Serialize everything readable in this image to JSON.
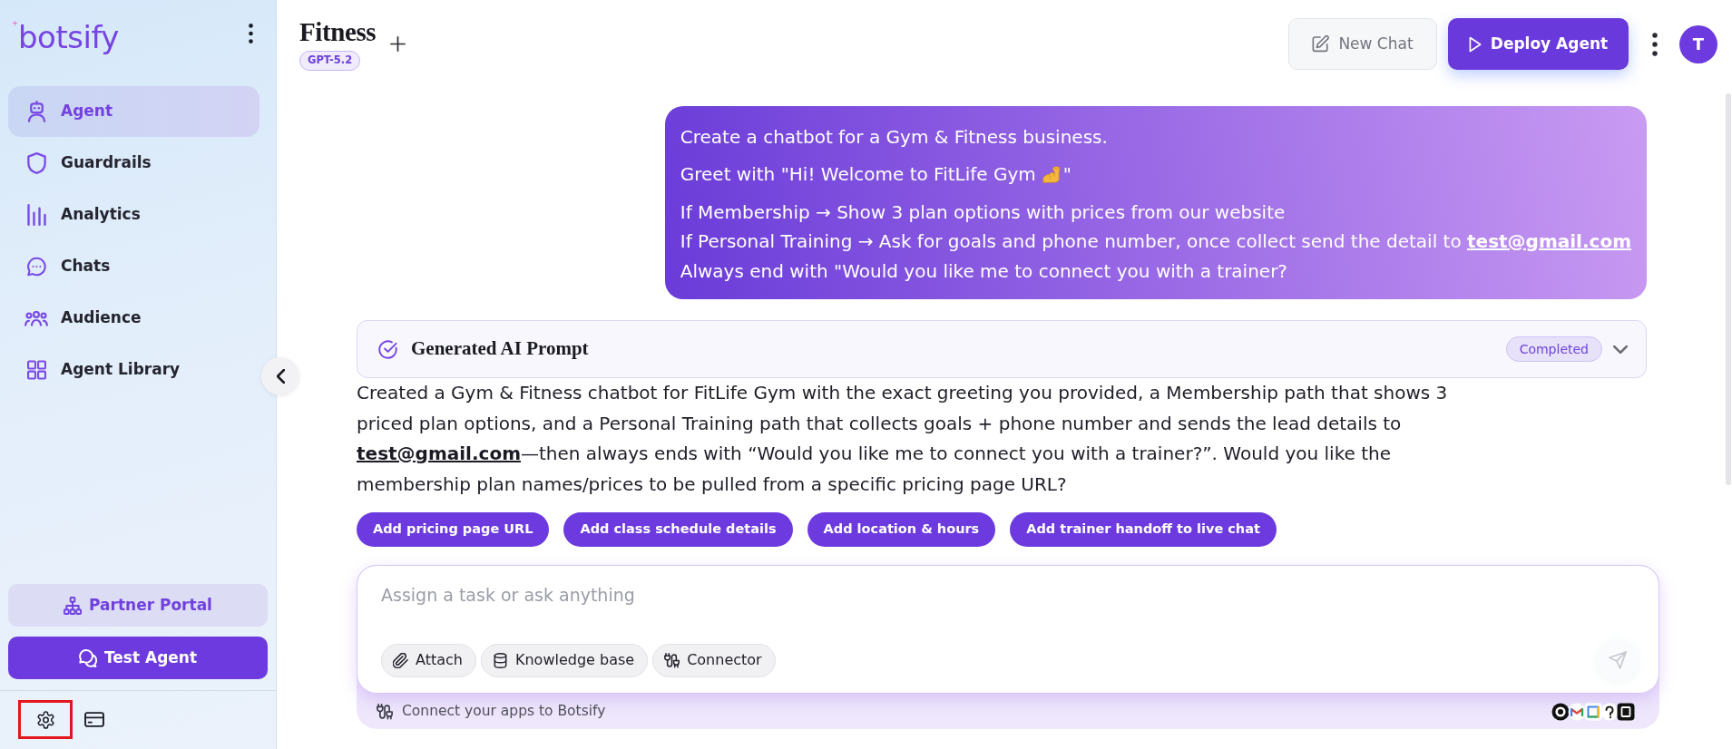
{
  "sidebar": {
    "logo": "botsify",
    "nav": [
      {
        "label": "Agent",
        "selected": true
      },
      {
        "label": "Guardrails",
        "selected": false
      },
      {
        "label": "Analytics",
        "selected": false
      },
      {
        "label": "Chats",
        "selected": false
      },
      {
        "label": "Audience",
        "selected": false
      },
      {
        "label": "Agent Library",
        "selected": false
      }
    ],
    "buttons": [
      {
        "label": "Partner Portal",
        "kind": "soft"
      },
      {
        "label": "Test Agent",
        "kind": "solid"
      }
    ],
    "settings_highlighted": true
  },
  "header": {
    "title": "Fitness",
    "model": "GPT-5.2",
    "buttons": [
      {
        "label": "New Chat",
        "kind": "soft"
      },
      {
        "label": "Deploy Agent",
        "kind": "solid"
      }
    ],
    "avatar": "T"
  },
  "chat": {
    "user_message": {
      "paragraphs": [
        {
          "lines": [
            {
              "segments": [
                {
                  "kind": "text",
                  "text": "Create a chatbot for a Gym & Fitness business."
                }
              ]
            }
          ]
        },
        {
          "lines": [
            {
              "segments": [
                {
                  "kind": "text",
                  "text": "Greet with \"Hi! Welcome to FitLife Gym"
                },
                {
                  "kind": "emoji"
                },
                {
                  "kind": "text",
                  "text": "\""
                }
              ]
            }
          ]
        },
        {
          "lines": [
            {
              "segments": [
                {
                  "kind": "text",
                  "text": "If Membership → Show 3 plan options with prices from our website"
                }
              ]
            },
            {
              "segments": [
                {
                  "kind": "text",
                  "text": "If Personal Training → Ask for goals and phone number, once collect send the detail to "
                },
                {
                  "kind": "link",
                  "text": "test@gmail.com"
                }
              ]
            },
            {
              "segments": [
                {
                  "kind": "text",
                  "text": "Always end with \"Would you like me to connect you with a trainer?"
                }
              ]
            }
          ]
        }
      ]
    },
    "prompt_card": {
      "title": "Generated AI Prompt",
      "status": "Completed",
      "expanded": false
    },
    "reply": {
      "segments": [
        {
          "kind": "text",
          "text": "Created a Gym & Fitness chatbot for FitLife Gym with the exact greeting you provided, a Membership path that shows 3 priced plan options, and a Personal Training path that collects goals + phone number and sends the lead details to "
        },
        {
          "kind": "link",
          "text": "test@gmail.com"
        },
        {
          "kind": "text",
          "text": "—then always ends with “Would you like me to connect you with a trainer?”. Would you like the membership plan names/prices to be pulled from a specific pricing page URL?"
        }
      ]
    },
    "suggestions": [
      "Add pricing page URL",
      "Add class schedule details",
      "Add location & hours",
      "Add trainer handoff to live chat"
    ]
  },
  "composer": {
    "placeholder": "Assign a task or ask anything",
    "tools": [
      "Attach",
      "Knowledge base",
      "Connector"
    ],
    "send_disabled": true,
    "footer": "Connect your apps to Botsify"
  }
}
